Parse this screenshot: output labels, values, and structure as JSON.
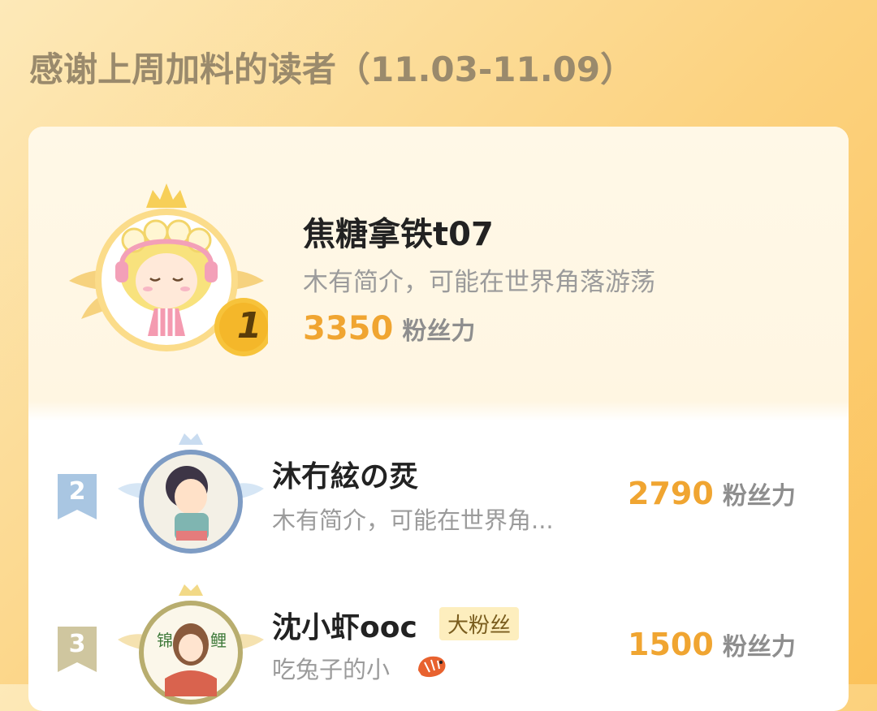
{
  "header": {
    "title": "感谢上周加料的读者（11.03-11.09）"
  },
  "colors": {
    "accent": "#f0a531",
    "background": "#fcd27f",
    "rank2": "#9fbfdc",
    "rank3": "#c9c19a"
  },
  "top_reader": {
    "rank": "1",
    "name": "焦糖拿铁t07",
    "bio": "木有简介，可能在世界角落游荡",
    "score": "3350",
    "unit": "粉丝力"
  },
  "readers": [
    {
      "rank": "2",
      "name": "沐冇絃の烎",
      "bio": "木有简介，可能在世界角...",
      "score": "2790",
      "unit": "粉丝力"
    },
    {
      "rank": "3",
      "name": "沈小虾ooc",
      "badge": "大粉丝",
      "bio": "吃兔子的小",
      "score": "1500",
      "unit": "粉丝力"
    }
  ]
}
